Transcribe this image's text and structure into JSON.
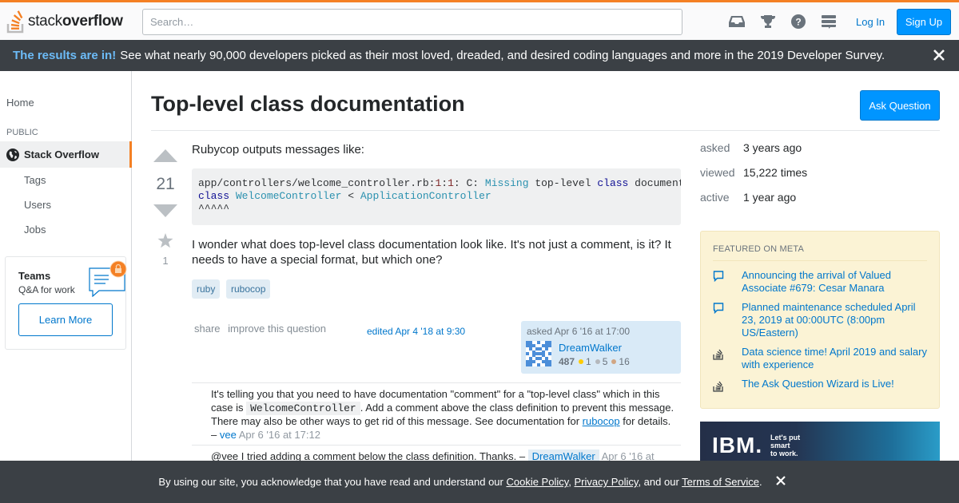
{
  "header": {
    "logo_text_light": "stack",
    "logo_text_bold": "overflow",
    "search_placeholder": "Search…",
    "login_label": "Log In",
    "signup_label": "Sign Up",
    "icons": [
      "inbox-icon",
      "trophy-icon",
      "help-icon",
      "site-switcher-icon"
    ]
  },
  "banner": {
    "highlight": "The results are in!",
    "text": "See what nearly 90,000 developers picked as their most loved, dreaded, and desired coding languages and more in the 2019 Developer Survey."
  },
  "leftnav": {
    "home": "Home",
    "section": "PUBLIC",
    "stackoverflow": "Stack Overflow",
    "tags": "Tags",
    "users": "Users",
    "jobs": "Jobs",
    "teams_title": "Teams",
    "teams_sub": "Q&A for work",
    "teams_button": "Learn More"
  },
  "question": {
    "title": "Top-level class documentation",
    "ask_button": "Ask Question",
    "votes": "21",
    "favorites": "1",
    "intro": "Rubycop outputs messages like:",
    "code": {
      "l1_path": "app/controllers/welcome_controller.rb:",
      "l1_num1": "1",
      "l1_colon": ":",
      "l1_num2": "1",
      "l1_mid": ": C: ",
      "l1_missing": "Missing",
      "l1_rest1": " top-level ",
      "l1_class": "class",
      "l1_rest2": " documentation comment.",
      "l2_class": "class",
      "l2_name": "WelcomeController",
      "l2_lt": " < ",
      "l2_parent": "ApplicationController",
      "l3": "^^^^^"
    },
    "body_line1": "I wonder what does top-level class documentation look like. It's not just a comment, is it? It",
    "body_line2": "needs to have a special format, but which one?",
    "tags": [
      "ruby",
      "rubocop"
    ],
    "menu_share": "share",
    "menu_improve": "improve this question",
    "edited": "edited Apr 4 '18 at 9:30",
    "owner": {
      "asked": "asked Apr 6 '16 at 17:00",
      "name": "DreamWalker",
      "rep": "487",
      "gold": "1",
      "silver": "5",
      "bronze": "16"
    }
  },
  "comments": [
    {
      "t1": "It's telling you that you need to have documentation \"comment\" for a \"top-level class\" which in this",
      "t2a": "case is ",
      "code": "WelcomeController",
      "t2b": ". Add a comment above the class definition to prevent this message.",
      "t3a": "There may also be other ways to get rid of this message. See documentation for ",
      "link": "rubocop",
      "t3b": " for details.",
      "dash": "– ",
      "user": "vee",
      "date": "Apr 6 '16 at 17:12"
    },
    {
      "text": "@vee I tried adding a comment below the class definition. Thanks. – ",
      "user": "DreamWalker",
      "date": "Apr 6 '16 at"
    }
  ],
  "stats": {
    "asked_label": "asked",
    "asked_value": "3 years ago",
    "viewed_label": "viewed",
    "viewed_value": "15,222 times",
    "active_label": "active",
    "active_value": "1 year ago"
  },
  "meta": {
    "heading": "FEATURED ON META",
    "items": [
      {
        "icon": "chat-bubble-icon",
        "text": "Announcing the arrival of Valued Associate #679: Cesar Manara"
      },
      {
        "icon": "chat-bubble-icon",
        "text": "Planned maintenance scheduled April 23, 2019 at 00:00UTC (8:00pm US/Eastern)"
      },
      {
        "icon": "stack-overflow-icon",
        "text": "Data science time! April 2019 and salary with experience"
      },
      {
        "icon": "stack-overflow-icon",
        "text": "The Ask Question Wizard is Live!"
      }
    ]
  },
  "ad": {
    "logo": "IBM.",
    "tagline_1": "Let's put",
    "tagline_2": "smart",
    "tagline_3": "to work."
  },
  "cookie": {
    "t1": "By using our site, you acknowledge that you have read and understand our ",
    "cookie_policy": "Cookie Policy",
    "sep1": ", ",
    "privacy_policy": "Privacy Policy",
    "sep2": ", and our ",
    "terms": "Terms of Service",
    "end": "."
  },
  "colors": {
    "accent_orange": "#f48024",
    "link_blue": "#0077cc",
    "button_blue": "#0095ff",
    "banner_bg": "#3b4045",
    "meta_bg": "#fbf3d5"
  }
}
